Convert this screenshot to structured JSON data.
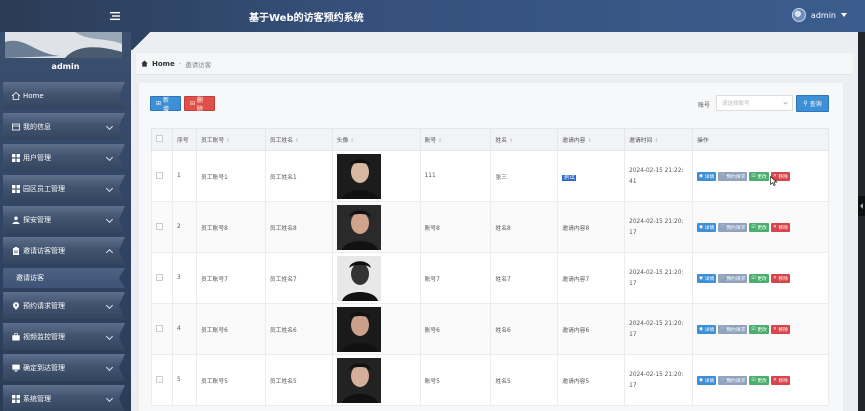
{
  "app": {
    "title": "基于Web的访客预约系统"
  },
  "user": {
    "name": "admin"
  },
  "sidebar": {
    "profile_name": "admin",
    "items": [
      {
        "label": "Home",
        "icon": "home-icon"
      },
      {
        "label": "我的信息",
        "icon": "profile-icon"
      },
      {
        "label": "用户管理",
        "icon": "grid-icon"
      },
      {
        "label": "园区员工管理",
        "icon": "grid-icon"
      },
      {
        "label": "探安管理",
        "icon": "person-icon"
      },
      {
        "label": "邀请访客管理",
        "icon": "clipboard-icon",
        "sub": "邀请访客"
      },
      {
        "label": "预约请求管理",
        "icon": "pin-icon"
      },
      {
        "label": "视频监控管理",
        "icon": "briefcase-icon"
      },
      {
        "label": "确定到达管理",
        "icon": "monitor-icon"
      },
      {
        "label": "系统管理",
        "icon": "grid-icon"
      }
    ]
  },
  "breadcrumb": {
    "home": "Home",
    "current": "邀请访客"
  },
  "toolbar": {
    "new_label": "新增",
    "delete_label": "删除",
    "search_label": "账号",
    "search_placeholder": "请选择账号",
    "search_button": "查询"
  },
  "table": {
    "headers": [
      "序号",
      "员工账号",
      "员工姓名",
      "头像",
      "账号",
      "姓名",
      "邀请内容",
      "邀请时间",
      "操作"
    ],
    "actions": {
      "detail": "详情",
      "request": "预约请求",
      "edit": "更改",
      "remove": "移除"
    },
    "rows": [
      {
        "no": "1",
        "emp_account": "员工账号1",
        "emp_name": "员工姓名1",
        "account": "111",
        "name": "张三",
        "content": "测试",
        "time_a": "2024-02-15 21:22:",
        "time_b": "41"
      },
      {
        "no": "2",
        "emp_account": "员工账号8",
        "emp_name": "员工姓名8",
        "account": "账号8",
        "name": "姓名8",
        "content": "邀请内容8",
        "time_a": "2024-02-15 21:20:",
        "time_b": "17"
      },
      {
        "no": "3",
        "emp_account": "员工账号7",
        "emp_name": "员工姓名7",
        "account": "账号7",
        "name": "姓名7",
        "content": "邀请内容7",
        "time_a": "2024-02-15 21:20:",
        "time_b": "17"
      },
      {
        "no": "4",
        "emp_account": "员工账号6",
        "emp_name": "员工姓名6",
        "account": "账号6",
        "name": "姓名6",
        "content": "邀请内容6",
        "time_a": "2024-02-15 21:20:",
        "time_b": "17"
      },
      {
        "no": "5",
        "emp_account": "员工账号5",
        "emp_name": "员工姓名5",
        "account": "账号5",
        "name": "姓名5",
        "content": "邀请内容5",
        "time_a": "2024-02-15 21:20:",
        "time_b": "17"
      }
    ]
  },
  "colors": {
    "topbar": "#2b3b55",
    "primary": "#3d8fd6",
    "danger": "#e0504a",
    "success": "#4cae6e"
  }
}
